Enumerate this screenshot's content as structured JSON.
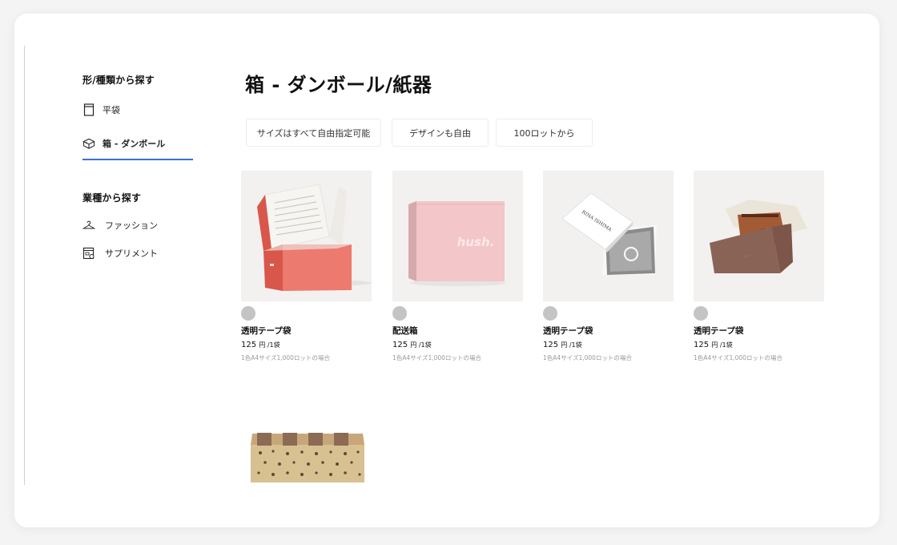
{
  "sidebar": {
    "section1_title": "形/種類から探す",
    "items1": [
      {
        "label": "平袋",
        "icon": "flat-bag-icon"
      },
      {
        "label": "箱 - ダンボール",
        "icon": "box-icon"
      }
    ],
    "section2_title": "業種から探す",
    "items2": [
      {
        "label": "ファッション",
        "icon": "hanger-icon"
      },
      {
        "label": "サプリメント",
        "icon": "supplement-icon"
      }
    ]
  },
  "main": {
    "title": "箱 - ダンボール/紙器",
    "tags": [
      "サイズはすべて自由指定可能",
      "デザインも自由",
      "100ロットから"
    ]
  },
  "products": [
    {
      "name": "透明テープ袋",
      "price": "125",
      "unit": "円 /1袋",
      "note": "1色A4サイズ1,000ロットの場合"
    },
    {
      "name": "配送箱",
      "price": "125",
      "unit": "円 /1袋",
      "note": "1色A4サイズ1,000ロットの場合",
      "brand_text": "hush."
    },
    {
      "name": "透明テープ袋",
      "price": "125",
      "unit": "円 /1袋",
      "note": "1色A4サイズ1,000ロットの場合",
      "brand_text": "RINA ISHIMA"
    },
    {
      "name": "透明テープ袋",
      "price": "125",
      "unit": "円 /1袋",
      "note": "1色A4サイズ1,000ロットの場合"
    }
  ],
  "colors": {
    "accent": "#3b6fd6",
    "dot": "#c4c4c4"
  }
}
